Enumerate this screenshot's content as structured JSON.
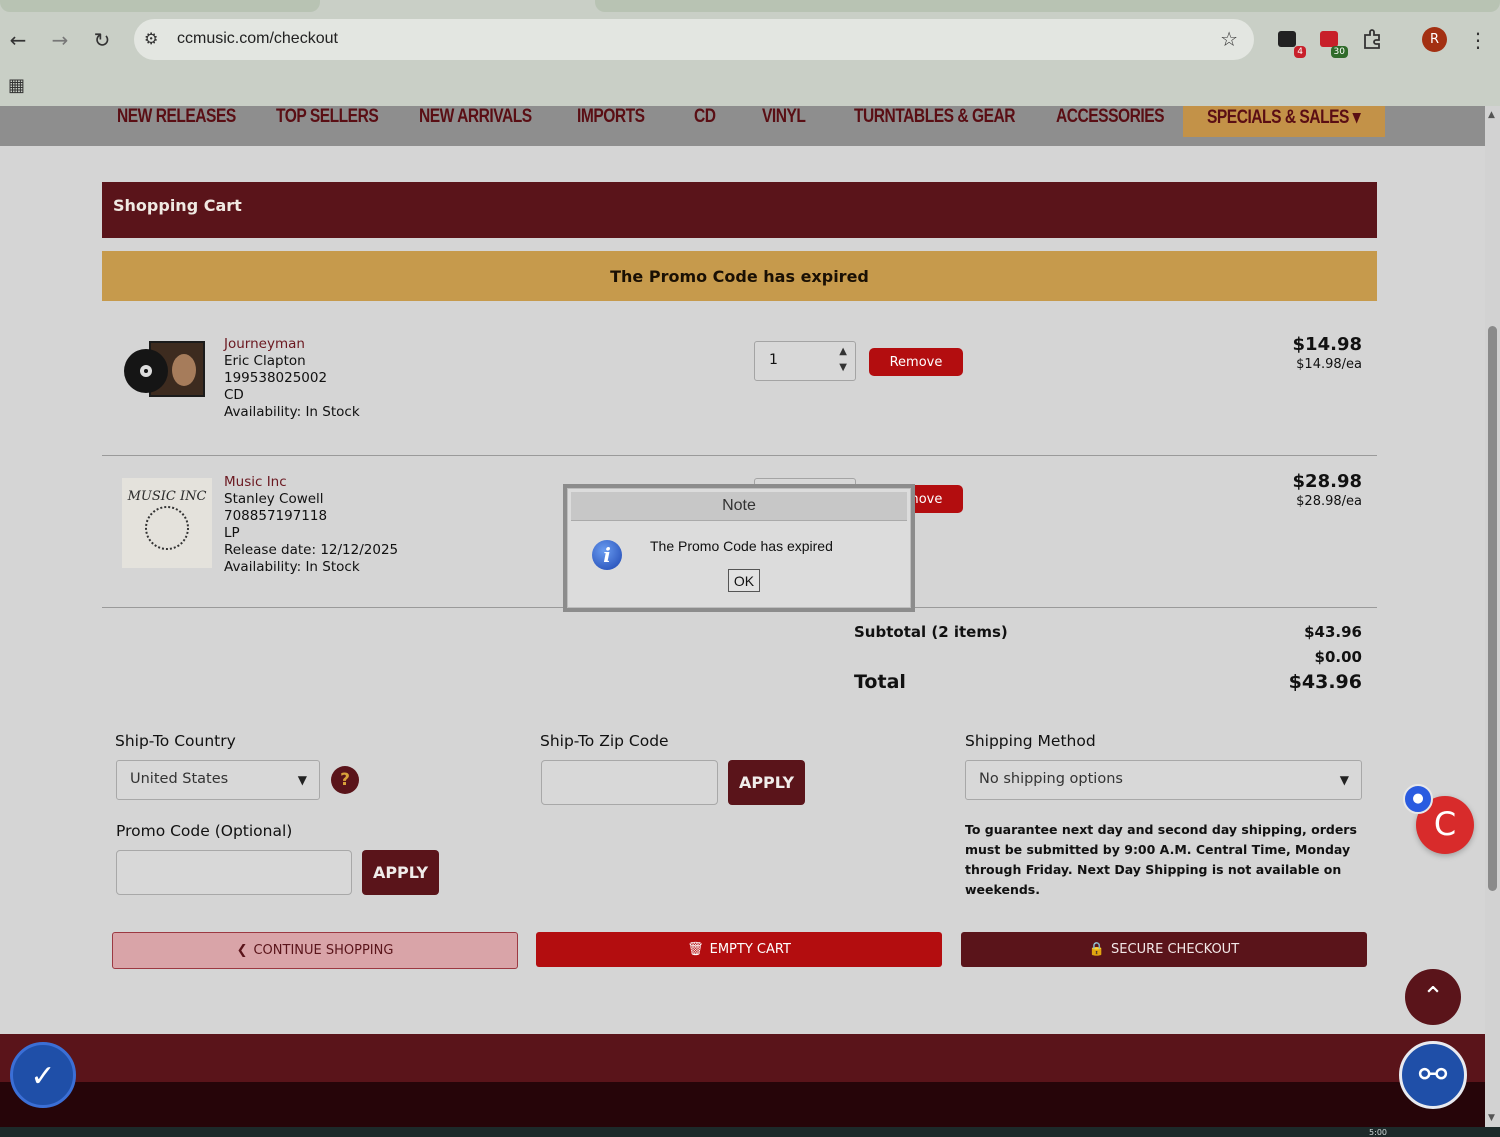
{
  "browser": {
    "url": "ccmusic.com/checkout",
    "extension_badges": [
      "4",
      "30"
    ],
    "profile_initial": "R"
  },
  "nav": {
    "items": [
      "NEW RELEASES",
      "TOP SELLERS",
      "NEW ARRIVALS",
      "IMPORTS",
      "CD",
      "VINYL",
      "TURNTABLES & GEAR",
      "ACCESSORIES"
    ],
    "special": "SPECIALS & SALES"
  },
  "cart": {
    "title": "Shopping Cart",
    "banner": "The Promo Code has expired",
    "items": [
      {
        "title": "Journeyman",
        "artist": "Eric Clapton",
        "sku": "199538025002",
        "format": "CD",
        "release": "",
        "availability": "Availability: In Stock",
        "qty": "1",
        "remove": "Remove",
        "price": "$14.98",
        "each": "$14.98/ea"
      },
      {
        "title": "Music Inc",
        "artist": "Stanley Cowell",
        "sku": "708857197118",
        "format": "LP",
        "release": "Release date: 12/12/2025",
        "availability": "Availability: In Stock",
        "qty": "",
        "remove": "Remove",
        "price": "$28.98",
        "each": "$28.98/ea"
      }
    ],
    "thumb2_text": "MUSIC INC",
    "subtotal_label": "Subtotal (2 items)",
    "subtotal_value": "$43.96",
    "discount_value": "$0.00",
    "total_label": "Total",
    "total_value": "$43.96"
  },
  "form": {
    "country_label": "Ship-To Country",
    "country_value": "United States",
    "help": "?",
    "zip_label": "Ship-To Zip Code",
    "zip_value": "",
    "apply": "APPLY",
    "shipping_label": "Shipping Method",
    "shipping_value": "No shipping options",
    "promo_label": "Promo Code (Optional)",
    "promo_value": "",
    "shipping_note": "To guarantee next day and second day shipping, orders must be submitted by 9:00 A.M. Central Time, Monday through Friday. Next Day Shipping is not available on weekends."
  },
  "buttons": {
    "continue": "CONTINUE SHOPPING",
    "empty": "EMPTY CART",
    "secure": "SECURE CHECKOUT"
  },
  "dialog": {
    "title": "Note",
    "message": "The Promo Code has expired",
    "ok": "OK"
  },
  "taskbar": {
    "clock": "5:00"
  },
  "colors": {
    "brand_maroon": "#5a141a",
    "remove_red": "#b30d0f",
    "gold": "#c69a4c",
    "nav_gray": "#8e8e8e"
  },
  "icons": [
    "back-icon",
    "forward-icon",
    "reload-icon",
    "site-info-icon",
    "star-icon",
    "extension-icon",
    "puzzle-icon",
    "apps-icon",
    "caret-down-icon",
    "help-icon",
    "chevron-left-circle-icon",
    "trash-icon",
    "lock-icon",
    "chevron-up-icon",
    "chat-icon",
    "accessibility-icon",
    "info-icon"
  ]
}
